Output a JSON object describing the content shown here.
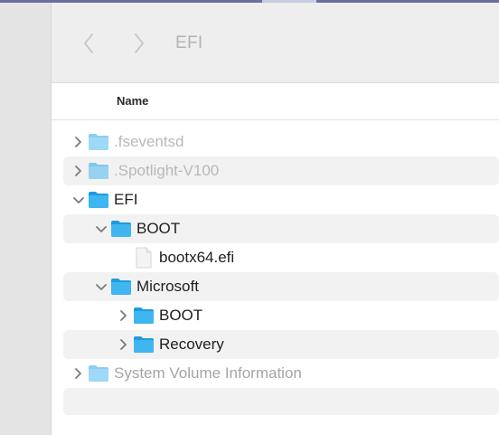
{
  "window": {
    "title": "EFI",
    "back_icon": "chevron-left-icon",
    "forward_icon": "chevron-right-icon"
  },
  "columns": {
    "name": "Name"
  },
  "colors": {
    "folder": "#3fb6f0",
    "folder_tab": "#1f9ae0",
    "dim_text": "#b8b8b8",
    "text": "#1e1e1e"
  },
  "rows": [
    {
      "label": ".fseventsd",
      "kind": "folder",
      "expanded": false,
      "depth": 0,
      "dim": true
    },
    {
      "label": ".Spotlight-V100",
      "kind": "folder",
      "expanded": false,
      "depth": 0,
      "dim": true
    },
    {
      "label": "EFI",
      "kind": "folder",
      "expanded": true,
      "depth": 0,
      "dim": false
    },
    {
      "label": "BOOT",
      "kind": "folder",
      "expanded": true,
      "depth": 1,
      "dim": false
    },
    {
      "label": "bootx64.efi",
      "kind": "file",
      "expanded": false,
      "depth": 2,
      "dim": false
    },
    {
      "label": "Microsoft",
      "kind": "folder",
      "expanded": true,
      "depth": 1,
      "dim": false
    },
    {
      "label": "BOOT",
      "kind": "folder",
      "expanded": false,
      "depth": 2,
      "dim": false
    },
    {
      "label": "Recovery",
      "kind": "folder",
      "expanded": false,
      "depth": 2,
      "dim": false
    },
    {
      "label": "System Volume Information",
      "kind": "folder",
      "expanded": false,
      "depth": 0,
      "dim": true
    }
  ]
}
